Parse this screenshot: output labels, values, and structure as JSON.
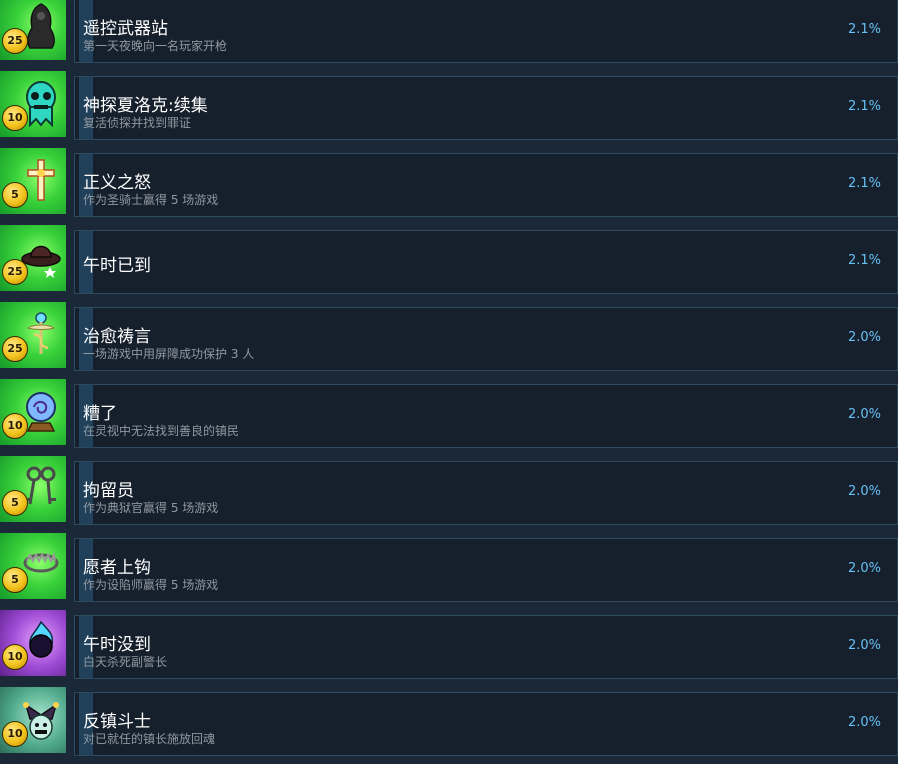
{
  "achievements": [
    {
      "title": "遥控武器站",
      "desc": "第一天夜晚向一名玩家开枪",
      "points": "25",
      "percent": "2.1%",
      "icon": "cloaked-figure-icon",
      "bg": "green"
    },
    {
      "title": "神探夏洛克:续集",
      "desc": "复活侦探并找到罪证",
      "points": "10",
      "percent": "2.1%",
      "icon": "ghost-skull-icon",
      "bg": "green"
    },
    {
      "title": "正义之怒",
      "desc": "作为圣骑士赢得 5 场游戏",
      "points": "5",
      "percent": "2.1%",
      "icon": "holy-cross-icon",
      "bg": "green"
    },
    {
      "title": "午时已到",
      "desc": "",
      "points": "25",
      "percent": "2.1%",
      "icon": "cowboy-hat-icon",
      "bg": "green"
    },
    {
      "title": "治愈祷言",
      "desc": "一场游戏中用屏障成功保护 3 人",
      "points": "25",
      "percent": "2.0%",
      "icon": "caduceus-icon",
      "bg": "green"
    },
    {
      "title": "糟了",
      "desc": "在灵视中无法找到善良的镇民",
      "points": "10",
      "percent": "2.0%",
      "icon": "crystal-ball-icon",
      "bg": "green"
    },
    {
      "title": "拘留员",
      "desc": "作为典狱官赢得 5 场游戏",
      "points": "5",
      "percent": "2.0%",
      "icon": "keys-icon",
      "bg": "green"
    },
    {
      "title": "愿者上钩",
      "desc": "作为设陷师赢得 5 场游戏",
      "points": "5",
      "percent": "2.0%",
      "icon": "bear-trap-icon",
      "bg": "green"
    },
    {
      "title": "午时没到",
      "desc": "白天杀死副警长",
      "points": "10",
      "percent": "2.0%",
      "icon": "dark-flame-orb-icon",
      "bg": "purple"
    },
    {
      "title": "反镇斗士",
      "desc": "对已就任的镇长施放回魂",
      "points": "10",
      "percent": "2.0%",
      "icon": "jester-hat-icon",
      "bg": "teal"
    }
  ]
}
